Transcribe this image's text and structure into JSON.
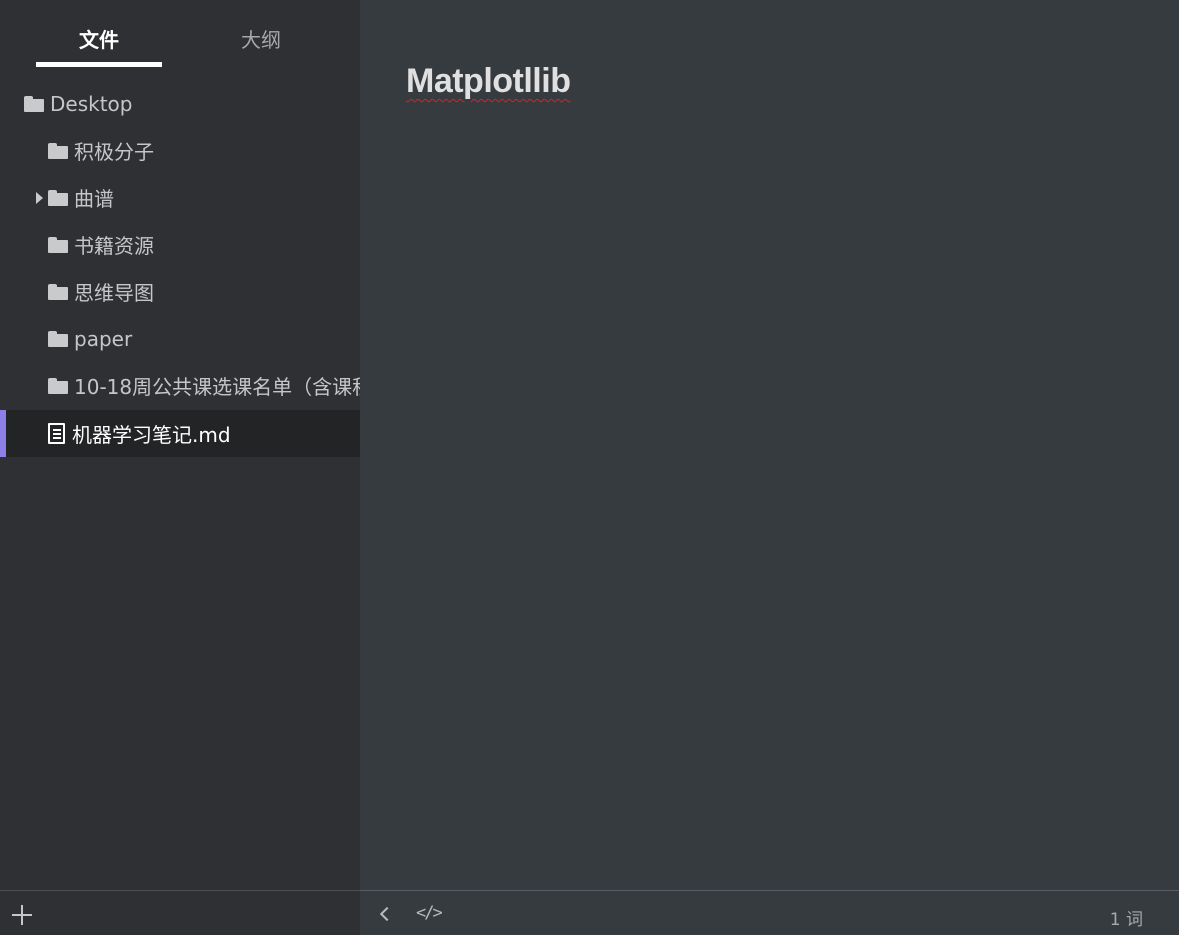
{
  "sidebar": {
    "tabs": [
      {
        "label": "文件",
        "active": true
      },
      {
        "label": "大纲",
        "active": false
      }
    ],
    "tree": [
      {
        "label": "Desktop",
        "type": "folder"
      },
      {
        "label": "积极分子",
        "type": "folder"
      },
      {
        "label": "曲谱",
        "type": "folder",
        "collapsed_caret": true
      },
      {
        "label": "书籍资源",
        "type": "folder"
      },
      {
        "label": "思维导图",
        "type": "folder"
      },
      {
        "label": "paper",
        "type": "folder"
      },
      {
        "label": "10-18周公共课选课名单（含课程",
        "type": "folder"
      },
      {
        "label": "机器学习笔记.md",
        "type": "file",
        "active": true
      }
    ]
  },
  "editor": {
    "title": "Matplotllib"
  },
  "footer": {
    "word_count": "1 词",
    "code_icon_glyph": "</>"
  },
  "colors": {
    "active_accent": "#8c7fe8",
    "sidebar_bg": "#2e3033",
    "editor_bg": "#363b40",
    "spellcheck_underline": "#d8232a"
  },
  "icons": [
    "folder-icon",
    "file-icon",
    "caret-right-icon",
    "add-icon",
    "back-icon",
    "code-icon"
  ]
}
